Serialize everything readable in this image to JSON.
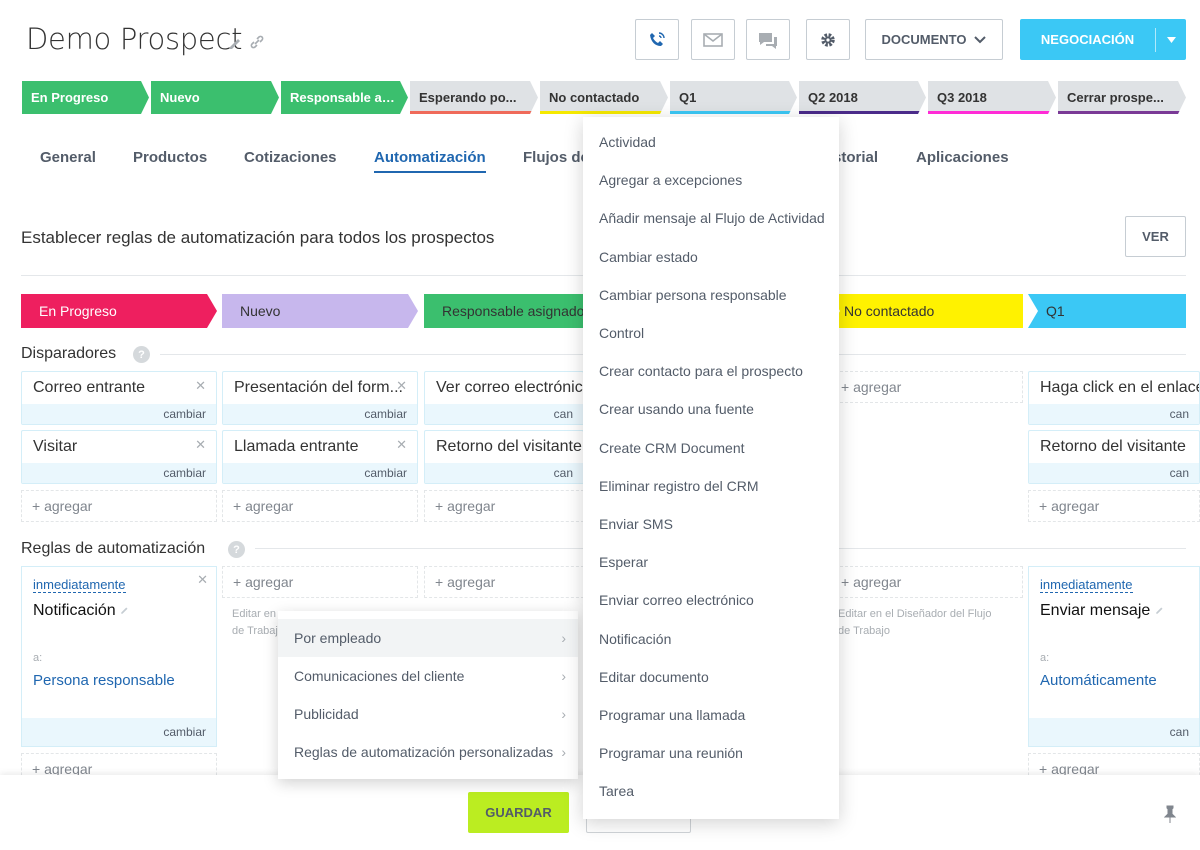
{
  "header": {
    "title": "Demo Prospect"
  },
  "toolbar": {
    "document_label": "DOCUMENTO",
    "negotiation_label": "NEGOCIACIÓN"
  },
  "stages": [
    {
      "label": "En Progreso",
      "bg": "#3bbf6e",
      "color": "#ffffff"
    },
    {
      "label": "Nuevo",
      "bg": "#3bbf6e",
      "color": "#ffffff"
    },
    {
      "label": "Responsable asignado",
      "bg": "#3bbf6e",
      "color": "#ffffff"
    },
    {
      "label": "Esperando po...",
      "bg": "#dfe2e5",
      "color": "#333333",
      "accent": "#ef6a5a"
    },
    {
      "label": "No contactado",
      "bg": "#dfe2e5",
      "color": "#333333",
      "accent": "#f5e900"
    },
    {
      "label": "Q1",
      "bg": "#dfe2e5",
      "color": "#333333",
      "accent": "#3bc8f5"
    },
    {
      "label": "Q2 2018",
      "bg": "#dfe2e5",
      "color": "#333333",
      "accent": "#4b2b8a"
    },
    {
      "label": "Q3 2018",
      "bg": "#dfe2e5",
      "color": "#333333",
      "accent": "#ff2bd6"
    },
    {
      "label": "Cerrar prospe...",
      "bg": "#dfe2e5",
      "color": "#333333",
      "accent": "#7a3a96"
    }
  ],
  "tabs": [
    "General",
    "Productos",
    "Cotizaciones",
    "Automatización",
    "Flujos de",
    "Historial",
    "Aplicaciones"
  ],
  "automation": {
    "heading": "Establecer reglas de automatización para todos los prospectos",
    "view_button": "VER"
  },
  "pipeline": [
    {
      "label": "En Progreso",
      "bg": "#ee1f5f",
      "color": "#ffffff"
    },
    {
      "label": "Nuevo",
      "bg": "#c7b7ed",
      "color": "#333333"
    },
    {
      "label": "Responsable asignado",
      "bg": "#3bbf6e",
      "color": "#333333"
    },
    {
      "label": "No contactado",
      "bg": "#fff200",
      "color": "#333333"
    },
    {
      "label": "Q1",
      "bg": "#3bc8f5",
      "color": "#333333"
    }
  ],
  "triggers": {
    "title": "Disparadores",
    "change_label": "cambiar",
    "add_label": "+ agregar",
    "col0": [
      "Correo entrante",
      "Visitar"
    ],
    "col1": [
      "Presentación del form...",
      "Llamada entrante"
    ],
    "col2": [
      "Ver correo electrónico",
      "Retorno del visitante"
    ],
    "col4": [
      "Haga click en el enlace",
      "Retorno del visitante"
    ],
    "short_change": "can"
  },
  "rules": {
    "title": "Reglas de automatización",
    "rule0": {
      "when": "inmediatamente",
      "name": "Notificación",
      "to_label": "a:",
      "to": "Persona responsable",
      "change": "cambiar"
    },
    "rule4": {
      "when": "inmediatamente",
      "name": "Enviar mensaje",
      "to_label": "a:",
      "to": "Automáticamente",
      "change": "can"
    },
    "hint_left": "Editar en\nde Trabajo",
    "hint_right": "Editar en el Diseñador del Flujo\nde Trabajo"
  },
  "footer": {
    "save": "GUARDAR"
  },
  "action_menu": [
    "Actividad",
    "Agregar a excepciones",
    "Añadir mensaje al Flujo de Actividad",
    "Cambiar estado",
    "Cambiar persona responsable",
    "Control",
    "Crear contacto para el prospecto",
    "Crear usando una fuente",
    "Create CRM Document",
    "Eliminar registro del CRM",
    "Enviar SMS",
    "Esperar",
    "Enviar correo electrónico",
    "Notificación",
    "Editar documento",
    "Programar una llamada",
    "Programar una reunión",
    "Tarea"
  ],
  "submenu": [
    "Por empleado",
    "Comunicaciones del cliente",
    "Publicidad",
    "Reglas de automatización personalizadas"
  ],
  "icons": {
    "chevron": "›"
  }
}
